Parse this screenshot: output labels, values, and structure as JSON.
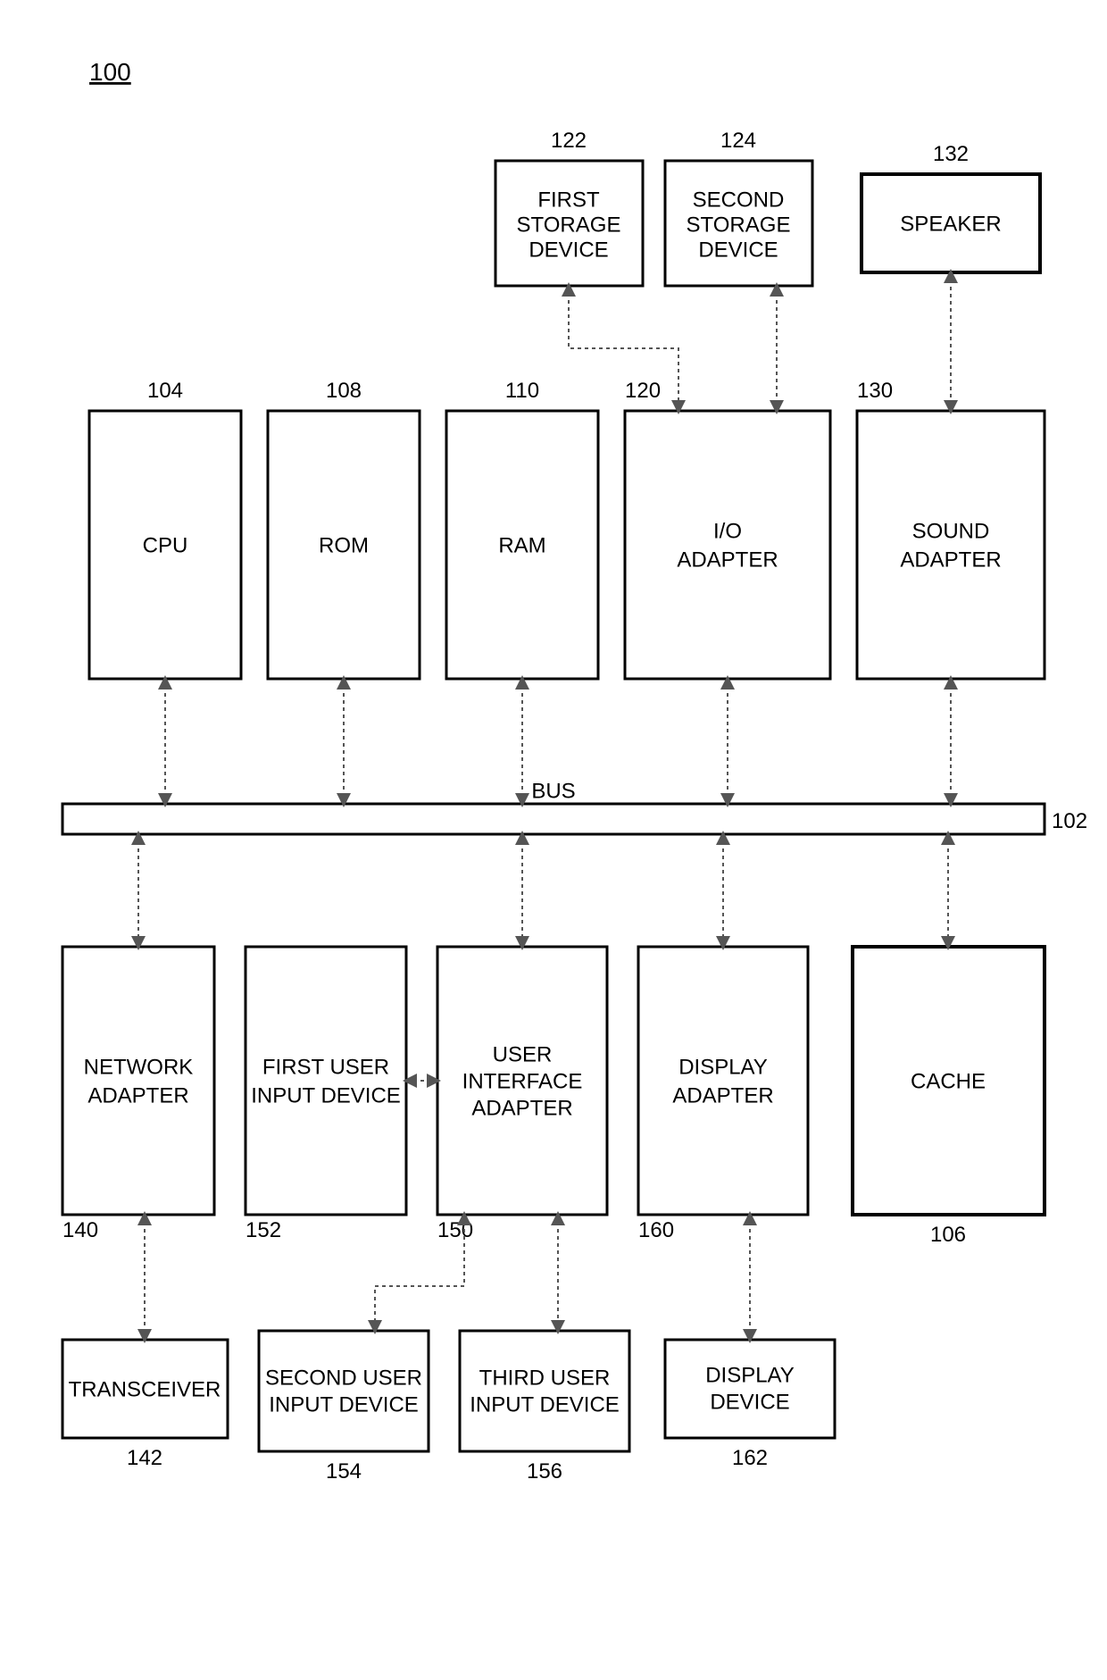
{
  "figure_ref": "100",
  "bus": {
    "label": "BUS",
    "ref": "102"
  },
  "blocks": {
    "cpu": {
      "label": "CPU",
      "ref": "104"
    },
    "rom": {
      "label": "ROM",
      "ref": "108"
    },
    "ram": {
      "label": "RAM",
      "ref": "110"
    },
    "io_adapter": {
      "label": "I/O ADAPTER",
      "ref": "120"
    },
    "sound_adapter": {
      "label": "SOUND ADAPTER",
      "ref": "130"
    },
    "first_storage": {
      "label": "FIRST STORAGE DEVICE",
      "ref": "122"
    },
    "second_storage": {
      "label": "SECOND STORAGE DEVICE",
      "ref": "124"
    },
    "speaker": {
      "label": "SPEAKER",
      "ref": "132"
    },
    "network_adapter": {
      "label": "NETWORK ADAPTER",
      "ref": "140"
    },
    "transceiver": {
      "label": "TRANSCEIVER",
      "ref": "142"
    },
    "ui_adapter": {
      "line1": "USER",
      "line2": "INTERFACE",
      "line3": "ADAPTER",
      "ref": "150"
    },
    "first_input": {
      "label": "FIRST USER INPUT DEVICE",
      "ref": "152"
    },
    "second_input": {
      "label": "SECOND USER INPUT DEVICE",
      "ref": "154"
    },
    "third_input": {
      "label": "THIRD USER INPUT DEVICE",
      "ref": "156"
    },
    "display_adapter": {
      "label": "DISPLAY ADAPTER",
      "ref": "160"
    },
    "display_device": {
      "label": "DISPLAY DEVICE",
      "ref": "162"
    },
    "cache": {
      "label": "CACHE",
      "ref": "106"
    }
  }
}
